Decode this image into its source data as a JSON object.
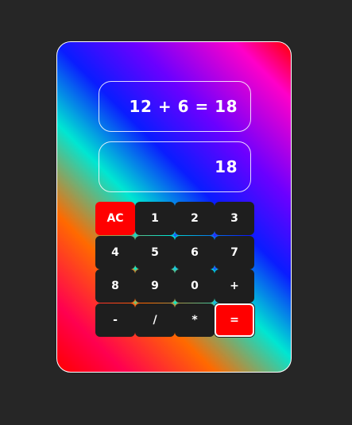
{
  "display": {
    "expression": "12 + 6 = 18",
    "result": "18"
  },
  "keys": [
    {
      "label": "AC",
      "name": "clear-button"
    },
    {
      "label": "1",
      "name": "digit-1-button"
    },
    {
      "label": "2",
      "name": "digit-2-button"
    },
    {
      "label": "3",
      "name": "digit-3-button"
    },
    {
      "label": "4",
      "name": "digit-4-button"
    },
    {
      "label": "5",
      "name": "digit-5-button"
    },
    {
      "label": "6",
      "name": "digit-6-button"
    },
    {
      "label": "7",
      "name": "digit-7-button"
    },
    {
      "label": "8",
      "name": "digit-8-button"
    },
    {
      "label": "9",
      "name": "digit-9-button"
    },
    {
      "label": "0",
      "name": "digit-0-button"
    },
    {
      "label": "+",
      "name": "plus-button"
    },
    {
      "label": "-",
      "name": "minus-button"
    },
    {
      "label": "/",
      "name": "divide-button"
    },
    {
      "label": "*",
      "name": "multiply-button"
    },
    {
      "label": "=",
      "name": "equals-button"
    }
  ],
  "colors": {
    "accent": "#ff0000",
    "key_bg": "#1e1e1e",
    "page_bg": "#262626"
  }
}
